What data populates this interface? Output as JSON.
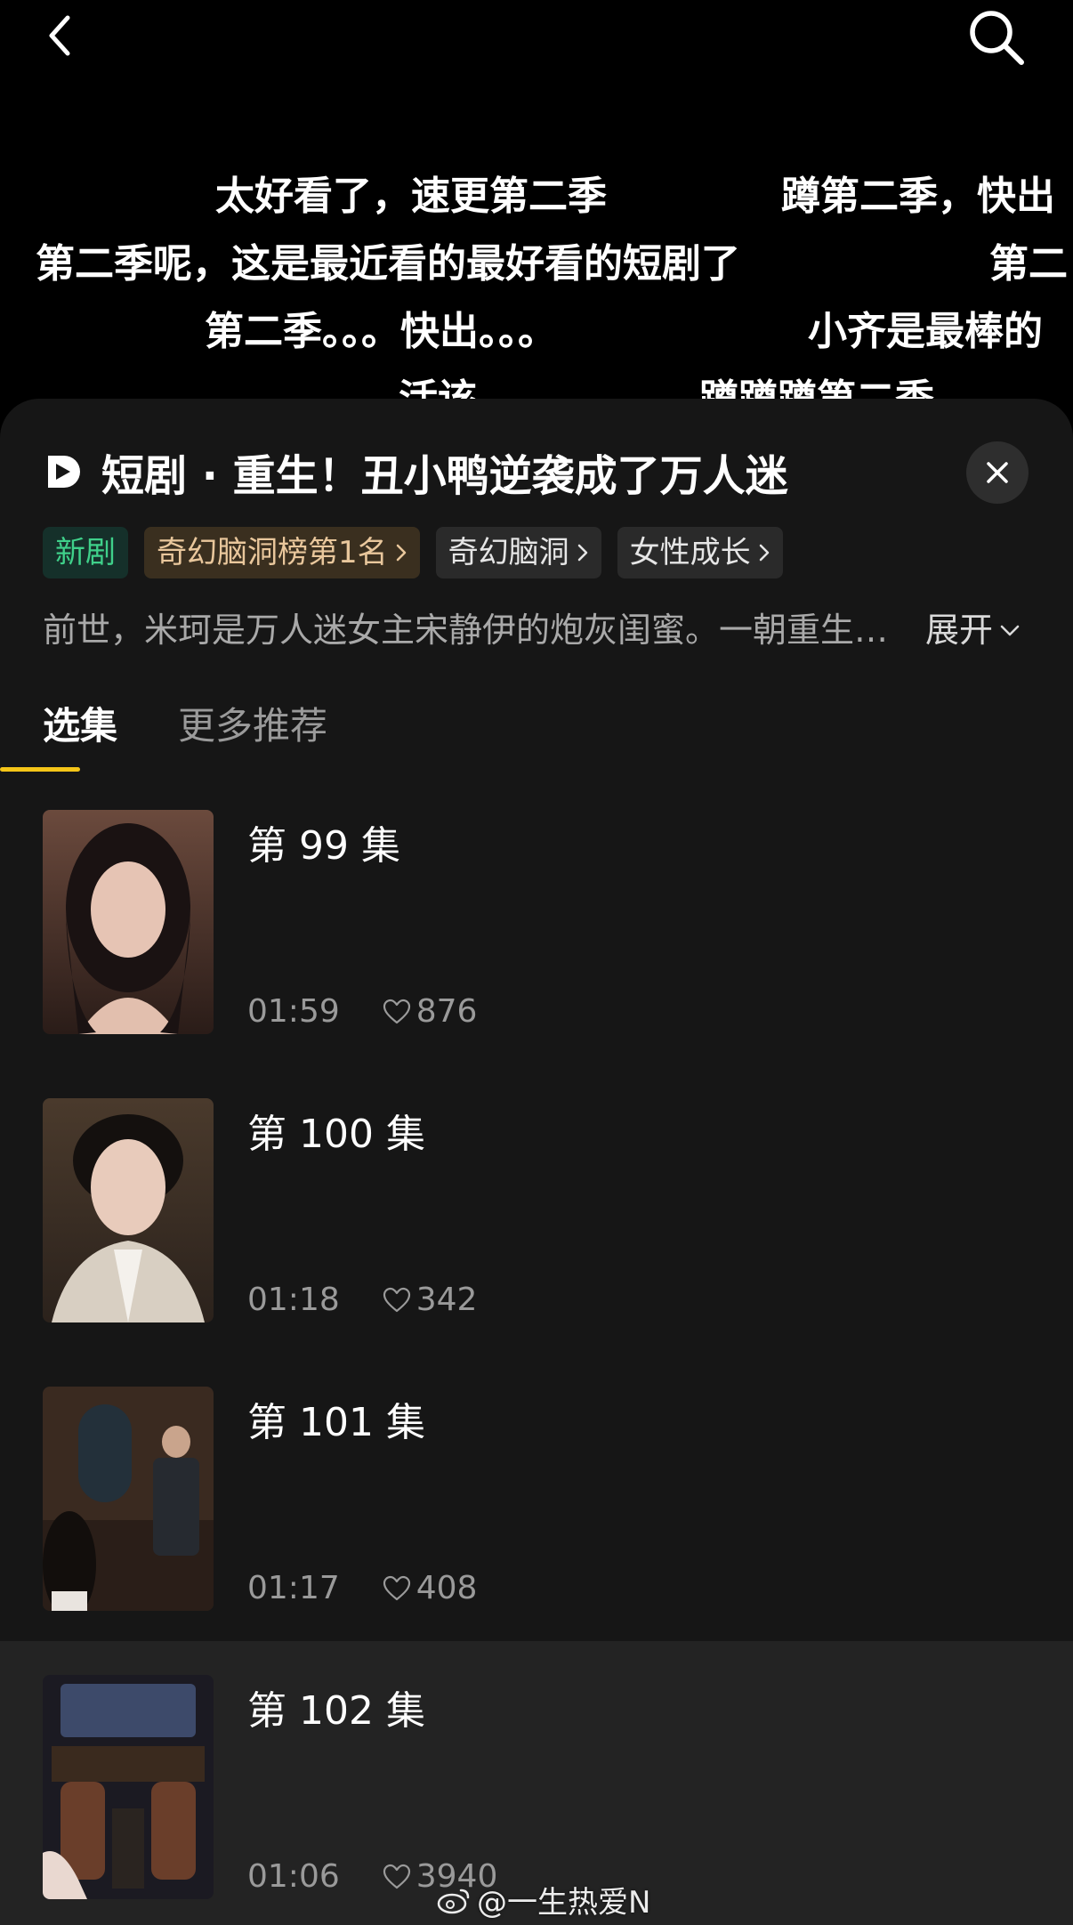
{
  "header": {
    "back_icon": "chevron-left-icon",
    "search_icon": "search-icon"
  },
  "danmaku": [
    "太好看了，速更第二季",
    "蹲第二季，快出",
    "第二季呢，这是最近看的最好看的短剧了",
    "第二",
    "第二季。。。快出。。。",
    "小齐是最棒的",
    "活该",
    "蹲蹲蹲第二季"
  ],
  "drama": {
    "title": "短剧 · 重生！丑小鸭逆袭成了万人迷",
    "tags": [
      "新剧",
      "奇幻脑洞榜第1名",
      "奇幻脑洞",
      "女性成长"
    ],
    "description": "前世，米珂是万人迷女主宋静伊的炮灰闺蜜。一朝重生，米珂决定不再做任何人的陪衬…",
    "expand_label": "展开"
  },
  "tabs": [
    "选集",
    "更多推荐"
  ],
  "episodes": [
    {
      "title": "第 99 集",
      "duration": "01:59",
      "likes": "876"
    },
    {
      "title": "第 100 集",
      "duration": "01:18",
      "likes": "342"
    },
    {
      "title": "第 101 集",
      "duration": "01:17",
      "likes": "408"
    },
    {
      "title": "第 102 集",
      "duration": "01:06",
      "likes": "3940"
    }
  ],
  "watermark": "@一生热爱N",
  "colors": {
    "accent": "#f5c518",
    "new_tag": "#3fd08a",
    "rank_tag": "#e9c79c",
    "panel": "#161616"
  }
}
